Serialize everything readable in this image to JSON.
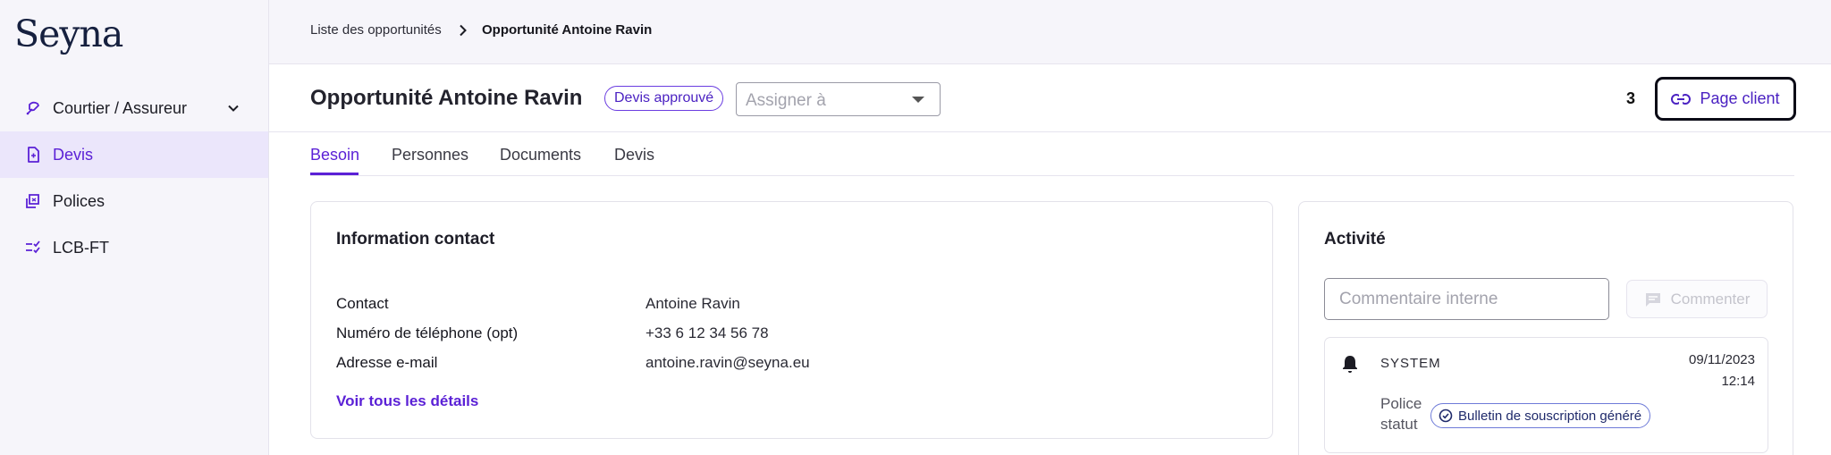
{
  "app": {
    "logo": "Seyna"
  },
  "sidebar": {
    "items": [
      {
        "label": "Courtier / Assureur",
        "icon": "broker-icon"
      },
      {
        "label": "Devis",
        "icon": "quote-document-icon"
      },
      {
        "label": "Polices",
        "icon": "policy-icon"
      },
      {
        "label": "LCB-FT",
        "icon": "checklist-icon"
      }
    ]
  },
  "breadcrumb": {
    "parent": "Liste des opportunités",
    "current": "Opportunité Antoine Ravin"
  },
  "header": {
    "title": "Opportunité Antoine Ravin",
    "status": "Devis approuvé",
    "assign_placeholder": "Assigner à",
    "count": "3",
    "client_page_label": "Page client"
  },
  "tabs": [
    {
      "label": "Besoin",
      "active": true
    },
    {
      "label": "Personnes",
      "active": false
    },
    {
      "label": "Documents",
      "active": false
    },
    {
      "label": "Devis",
      "active": false
    }
  ],
  "contact": {
    "title": "Information contact",
    "fields": [
      {
        "label": "Contact",
        "value": "Antoine Ravin"
      },
      {
        "label": "Numéro de téléphone (opt)",
        "value": "+33 6 12 34 56 78"
      },
      {
        "label": "Adresse e-mail",
        "value": "antoine.ravin@seyna.eu"
      }
    ],
    "details_link": "Voir tous les détails"
  },
  "activity": {
    "title": "Activité",
    "comment_placeholder": "Commentaire interne",
    "comment_button": "Commenter",
    "events": [
      {
        "source": "SYSTEM",
        "date": "09/11/2023",
        "time": "12:14",
        "label": "Police statut",
        "badge": "Bulletin de souscription généré"
      }
    ]
  },
  "colors": {
    "accent": "#5b21d6",
    "sidebar_bg": "#f6f5fa",
    "active_bg": "#ebe6fb",
    "badge_border": "#6a3de0"
  }
}
